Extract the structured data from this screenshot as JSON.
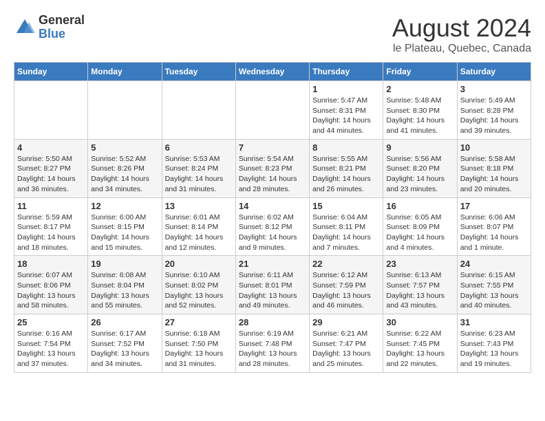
{
  "header": {
    "logo_general": "General",
    "logo_blue": "Blue",
    "title": "August 2024",
    "subtitle": "le Plateau, Quebec, Canada"
  },
  "days_of_week": [
    "Sunday",
    "Monday",
    "Tuesday",
    "Wednesday",
    "Thursday",
    "Friday",
    "Saturday"
  ],
  "weeks": [
    [
      {
        "day": "",
        "info": ""
      },
      {
        "day": "",
        "info": ""
      },
      {
        "day": "",
        "info": ""
      },
      {
        "day": "",
        "info": ""
      },
      {
        "day": "1",
        "info": "Sunrise: 5:47 AM\nSunset: 8:31 PM\nDaylight: 14 hours and 44 minutes."
      },
      {
        "day": "2",
        "info": "Sunrise: 5:48 AM\nSunset: 8:30 PM\nDaylight: 14 hours and 41 minutes."
      },
      {
        "day": "3",
        "info": "Sunrise: 5:49 AM\nSunset: 8:28 PM\nDaylight: 14 hours and 39 minutes."
      }
    ],
    [
      {
        "day": "4",
        "info": "Sunrise: 5:50 AM\nSunset: 8:27 PM\nDaylight: 14 hours and 36 minutes."
      },
      {
        "day": "5",
        "info": "Sunrise: 5:52 AM\nSunset: 8:26 PM\nDaylight: 14 hours and 34 minutes."
      },
      {
        "day": "6",
        "info": "Sunrise: 5:53 AM\nSunset: 8:24 PM\nDaylight: 14 hours and 31 minutes."
      },
      {
        "day": "7",
        "info": "Sunrise: 5:54 AM\nSunset: 8:23 PM\nDaylight: 14 hours and 28 minutes."
      },
      {
        "day": "8",
        "info": "Sunrise: 5:55 AM\nSunset: 8:21 PM\nDaylight: 14 hours and 26 minutes."
      },
      {
        "day": "9",
        "info": "Sunrise: 5:56 AM\nSunset: 8:20 PM\nDaylight: 14 hours and 23 minutes."
      },
      {
        "day": "10",
        "info": "Sunrise: 5:58 AM\nSunset: 8:18 PM\nDaylight: 14 hours and 20 minutes."
      }
    ],
    [
      {
        "day": "11",
        "info": "Sunrise: 5:59 AM\nSunset: 8:17 PM\nDaylight: 14 hours and 18 minutes."
      },
      {
        "day": "12",
        "info": "Sunrise: 6:00 AM\nSunset: 8:15 PM\nDaylight: 14 hours and 15 minutes."
      },
      {
        "day": "13",
        "info": "Sunrise: 6:01 AM\nSunset: 8:14 PM\nDaylight: 14 hours and 12 minutes."
      },
      {
        "day": "14",
        "info": "Sunrise: 6:02 AM\nSunset: 8:12 PM\nDaylight: 14 hours and 9 minutes."
      },
      {
        "day": "15",
        "info": "Sunrise: 6:04 AM\nSunset: 8:11 PM\nDaylight: 14 hours and 7 minutes."
      },
      {
        "day": "16",
        "info": "Sunrise: 6:05 AM\nSunset: 8:09 PM\nDaylight: 14 hours and 4 minutes."
      },
      {
        "day": "17",
        "info": "Sunrise: 6:06 AM\nSunset: 8:07 PM\nDaylight: 14 hours and 1 minute."
      }
    ],
    [
      {
        "day": "18",
        "info": "Sunrise: 6:07 AM\nSunset: 8:06 PM\nDaylight: 13 hours and 58 minutes."
      },
      {
        "day": "19",
        "info": "Sunrise: 6:08 AM\nSunset: 8:04 PM\nDaylight: 13 hours and 55 minutes."
      },
      {
        "day": "20",
        "info": "Sunrise: 6:10 AM\nSunset: 8:02 PM\nDaylight: 13 hours and 52 minutes."
      },
      {
        "day": "21",
        "info": "Sunrise: 6:11 AM\nSunset: 8:01 PM\nDaylight: 13 hours and 49 minutes."
      },
      {
        "day": "22",
        "info": "Sunrise: 6:12 AM\nSunset: 7:59 PM\nDaylight: 13 hours and 46 minutes."
      },
      {
        "day": "23",
        "info": "Sunrise: 6:13 AM\nSunset: 7:57 PM\nDaylight: 13 hours and 43 minutes."
      },
      {
        "day": "24",
        "info": "Sunrise: 6:15 AM\nSunset: 7:55 PM\nDaylight: 13 hours and 40 minutes."
      }
    ],
    [
      {
        "day": "25",
        "info": "Sunrise: 6:16 AM\nSunset: 7:54 PM\nDaylight: 13 hours and 37 minutes."
      },
      {
        "day": "26",
        "info": "Sunrise: 6:17 AM\nSunset: 7:52 PM\nDaylight: 13 hours and 34 minutes."
      },
      {
        "day": "27",
        "info": "Sunrise: 6:18 AM\nSunset: 7:50 PM\nDaylight: 13 hours and 31 minutes."
      },
      {
        "day": "28",
        "info": "Sunrise: 6:19 AM\nSunset: 7:48 PM\nDaylight: 13 hours and 28 minutes."
      },
      {
        "day": "29",
        "info": "Sunrise: 6:21 AM\nSunset: 7:47 PM\nDaylight: 13 hours and 25 minutes."
      },
      {
        "day": "30",
        "info": "Sunrise: 6:22 AM\nSunset: 7:45 PM\nDaylight: 13 hours and 22 minutes."
      },
      {
        "day": "31",
        "info": "Sunrise: 6:23 AM\nSunset: 7:43 PM\nDaylight: 13 hours and 19 minutes."
      }
    ]
  ]
}
